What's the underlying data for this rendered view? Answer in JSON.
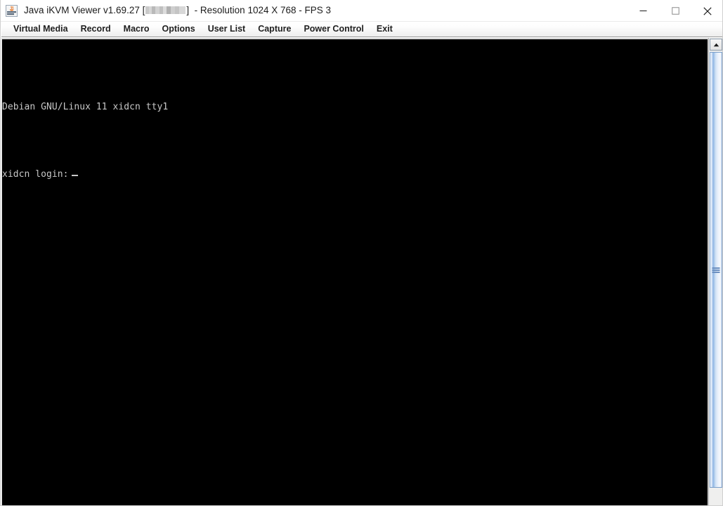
{
  "window": {
    "title_prefix": "Java iKVM Viewer v1.69.27",
    "title_bracket_open": "[",
    "title_redacted_placeholder": "",
    "title_bracket_close": "]",
    "title_suffix": "- Resolution 1024 X 768 - FPS 3",
    "icon": "java-coffee-cup-icon",
    "controls": {
      "minimize_label": "Minimize",
      "maximize_label": "Maximize",
      "close_label": "Close"
    }
  },
  "menu_bar": {
    "items": [
      {
        "label": "Virtual Media",
        "name": "menu-item-virtual-media"
      },
      {
        "label": "Record",
        "name": "menu-item-record"
      },
      {
        "label": "Macro",
        "name": "menu-item-macro"
      },
      {
        "label": "Options",
        "name": "menu-item-options"
      },
      {
        "label": "User List",
        "name": "menu-item-user-list"
      },
      {
        "label": "Capture",
        "name": "menu-item-capture"
      },
      {
        "label": "Power Control",
        "name": "menu-item-power-control"
      },
      {
        "label": "Exit",
        "name": "menu-item-exit"
      }
    ]
  },
  "console": {
    "line1": "Debian GNU/Linux 11 xidcn tty1",
    "line2": "",
    "login_prompt": "xidcn login:",
    "cursor": "_",
    "background_color": "#000000",
    "text_color": "#c8c8c8"
  },
  "scrollbar": {
    "up_arrow_icon": "triangle-up-icon",
    "thumb_grip_icon": "grip-lines-icon",
    "orientation": "vertical"
  },
  "colors": {
    "menu_bar_bg": "#f3f3f3",
    "scroll_thumb_accent": "#8fb6e4",
    "title_bar_bg": "#ffffff"
  }
}
